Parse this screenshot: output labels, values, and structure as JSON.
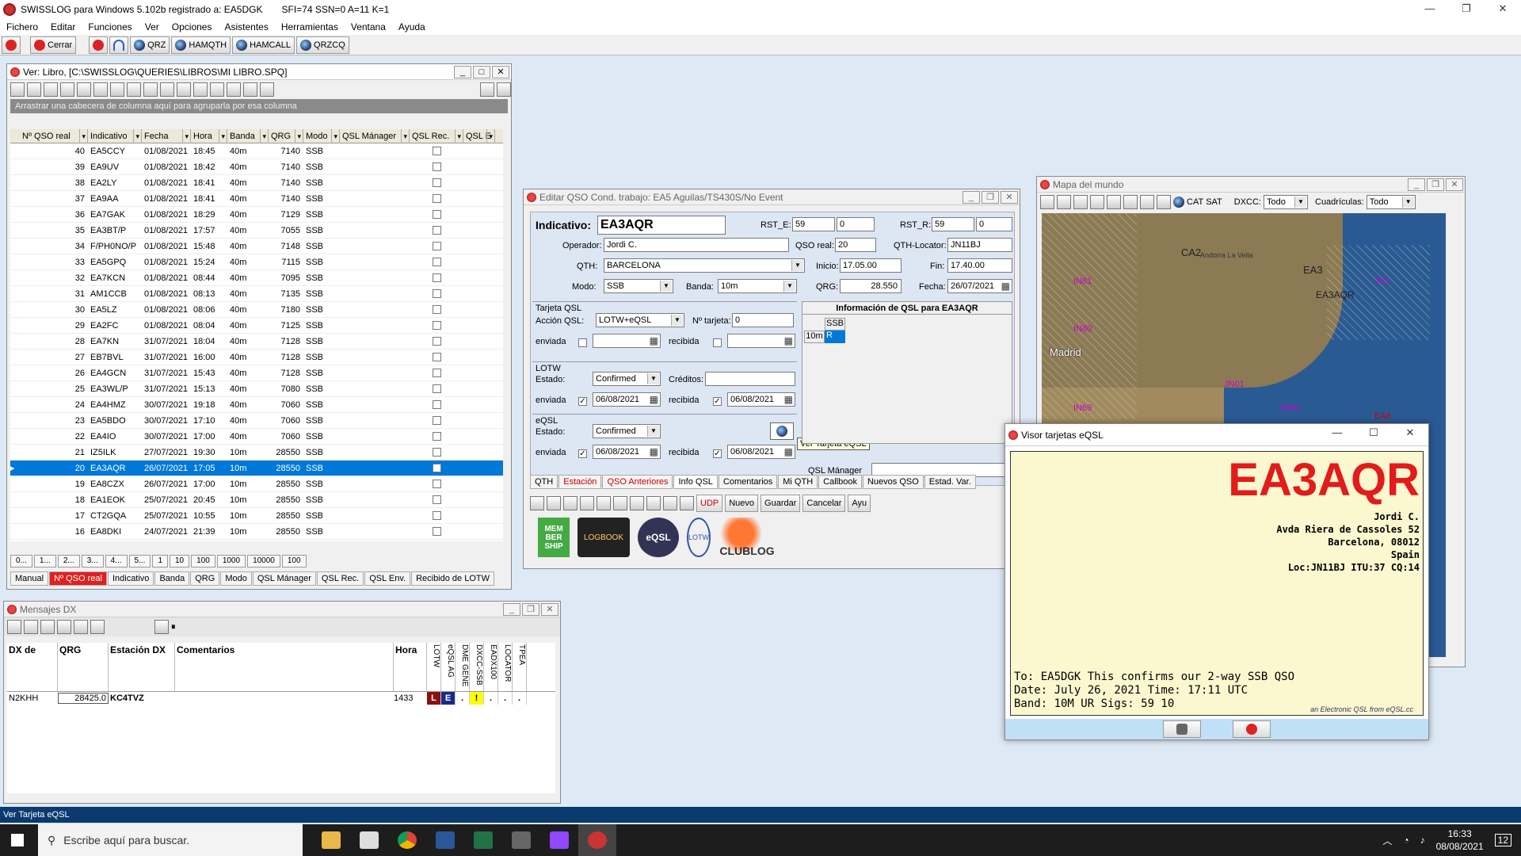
{
  "app": {
    "title": "SWISSLOG para Windows 5.102b registrado a: EA5DGK",
    "solar": "SFI=74 SSN=0 A=11 K=1"
  },
  "menu": [
    "Fichero",
    "Editar",
    "Funciones",
    "Ver",
    "Opciones",
    "Asistentes",
    "Herramientas",
    "Ventana",
    "Ayuda"
  ],
  "toolbar": {
    "close": "Cerrar",
    "qrz": "QRZ",
    "hamqth": "HAMQTH",
    "hamcall": "HAMCALL",
    "qrzcq": "QRZCQ"
  },
  "log": {
    "title": "Ver: Libro, [C:\\SWISSLOG\\QUERIES\\LIBROS\\MI LIBRO.SPQ]",
    "group_hint": "Arrastrar una cabecera de columna aquí para agruparla por esa columna",
    "columns": [
      "Nº QSO real",
      "Indicativo",
      "Fecha",
      "Hora",
      "Banda",
      "QRG",
      "Modo",
      "QSL Mánager",
      "QSL Rec.",
      "QSL E"
    ],
    "rows": [
      {
        "n": "40",
        "call": "EA5CCY",
        "date": "01/08/2021",
        "time": "18:45",
        "band": "40m",
        "qrg": "7140",
        "mode": "SSB"
      },
      {
        "n": "39",
        "call": "EA9UV",
        "date": "01/08/2021",
        "time": "18:42",
        "band": "40m",
        "qrg": "7140",
        "mode": "SSB"
      },
      {
        "n": "38",
        "call": "EA2LY",
        "date": "01/08/2021",
        "time": "18:41",
        "band": "40m",
        "qrg": "7140",
        "mode": "SSB"
      },
      {
        "n": "37",
        "call": "EA9AA",
        "date": "01/08/2021",
        "time": "18:41",
        "band": "40m",
        "qrg": "7140",
        "mode": "SSB"
      },
      {
        "n": "36",
        "call": "EA7GAK",
        "date": "01/08/2021",
        "time": "18:29",
        "band": "40m",
        "qrg": "7129",
        "mode": "SSB"
      },
      {
        "n": "35",
        "call": "EA3BT/P",
        "date": "01/08/2021",
        "time": "17:57",
        "band": "40m",
        "qrg": "7055",
        "mode": "SSB"
      },
      {
        "n": "34",
        "call": "F/PH0NO/P",
        "date": "01/08/2021",
        "time": "15:48",
        "band": "40m",
        "qrg": "7148",
        "mode": "SSB"
      },
      {
        "n": "33",
        "call": "EA5GPQ",
        "date": "01/08/2021",
        "time": "15:24",
        "band": "40m",
        "qrg": "7115",
        "mode": "SSB"
      },
      {
        "n": "32",
        "call": "EA7KCN",
        "date": "01/08/2021",
        "time": "08:44",
        "band": "40m",
        "qrg": "7095",
        "mode": "SSB"
      },
      {
        "n": "31",
        "call": "AM1CCB",
        "date": "01/08/2021",
        "time": "08:13",
        "band": "40m",
        "qrg": "7135",
        "mode": "SSB"
      },
      {
        "n": "30",
        "call": "EA5LZ",
        "date": "01/08/2021",
        "time": "08:06",
        "band": "40m",
        "qrg": "7180",
        "mode": "SSB"
      },
      {
        "n": "29",
        "call": "EA2FC",
        "date": "01/08/2021",
        "time": "08:04",
        "band": "40m",
        "qrg": "7125",
        "mode": "SSB"
      },
      {
        "n": "28",
        "call": "EA7KN",
        "date": "31/07/2021",
        "time": "18:04",
        "band": "40m",
        "qrg": "7128",
        "mode": "SSB"
      },
      {
        "n": "27",
        "call": "EB7BVL",
        "date": "31/07/2021",
        "time": "16:00",
        "band": "40m",
        "qrg": "7128",
        "mode": "SSB"
      },
      {
        "n": "26",
        "call": "EA4GCN",
        "date": "31/07/2021",
        "time": "15:43",
        "band": "40m",
        "qrg": "7128",
        "mode": "SSB"
      },
      {
        "n": "25",
        "call": "EA3WL/P",
        "date": "31/07/2021",
        "time": "15:13",
        "band": "40m",
        "qrg": "7080",
        "mode": "SSB"
      },
      {
        "n": "24",
        "call": "EA4HMZ",
        "date": "30/07/2021",
        "time": "19:18",
        "band": "40m",
        "qrg": "7060",
        "mode": "SSB"
      },
      {
        "n": "23",
        "call": "EA5BDO",
        "date": "30/07/2021",
        "time": "17:10",
        "band": "40m",
        "qrg": "7060",
        "mode": "SSB"
      },
      {
        "n": "22",
        "call": "EA4IO",
        "date": "30/07/2021",
        "time": "17:00",
        "band": "40m",
        "qrg": "7060",
        "mode": "SSB"
      },
      {
        "n": "21",
        "call": "IZ5ILK",
        "date": "27/07/2021",
        "time": "19:30",
        "band": "10m",
        "qrg": "28550",
        "mode": "SSB"
      },
      {
        "n": "20",
        "call": "EA3AQR",
        "date": "26/07/2021",
        "time": "17:05",
        "band": "10m",
        "qrg": "28550",
        "mode": "SSB",
        "sel": true
      },
      {
        "n": "19",
        "call": "EA8CZX",
        "date": "26/07/2021",
        "time": "17:00",
        "band": "10m",
        "qrg": "28550",
        "mode": "SSB"
      },
      {
        "n": "18",
        "call": "EA1EOK",
        "date": "25/07/2021",
        "time": "20:45",
        "band": "10m",
        "qrg": "28550",
        "mode": "SSB"
      },
      {
        "n": "17",
        "call": "CT2GQA",
        "date": "25/07/2021",
        "time": "10:55",
        "band": "10m",
        "qrg": "28550",
        "mode": "SSB"
      },
      {
        "n": "16",
        "call": "EA8DKI",
        "date": "24/07/2021",
        "time": "21:39",
        "band": "10m",
        "qrg": "28550",
        "mode": "SSB"
      }
    ],
    "nav_labels": [
      "0...",
      "1...",
      "2...",
      "3...",
      "4...",
      "5...",
      "1",
      "10",
      "100",
      "1000",
      "10000",
      "100"
    ],
    "tabs": [
      "Manual",
      "Nº QSO real",
      "Indicativo",
      "Banda",
      "QRG",
      "Modo",
      "QSL Mánager",
      "QSL Rec.",
      "QSL Env.",
      "Recibido de LOTW"
    ]
  },
  "edit": {
    "title": "Editar QSO  Cond. trabajo: EA5 Aguilas/TS430S/No Event",
    "indicativo_label": "Indicativo:",
    "indicativo": "EA3AQR",
    "rst_e_label": "RST_E:",
    "rst_e": "59",
    "rst_e2": "0",
    "rst_r_label": "RST_R:",
    "rst_r": "59",
    "rst_r2": "0",
    "operador_label": "Operador:",
    "operador": "Jordi C.",
    "qso_real_label": "QSO real:",
    "qso_real": "20",
    "locator_label": "QTH-Locator:",
    "locator": "JN11BJ",
    "qth_label": "QTH:",
    "qth": "BARCELONA",
    "inicio_label": "Inicio:",
    "inicio": "17.05.00",
    "fin_label": "Fin:",
    "fin": "17.40.00",
    "modo_label": "Modo:",
    "modo": "SSB",
    "banda_label": "Banda:",
    "banda": "10m",
    "qrg_label": "QRG:",
    "qrg": "28.550",
    "fecha_label": "Fecha:",
    "fecha": "26/07/2021",
    "tarjeta_label": "Tarjeta QSL",
    "accion_label": "Acción QSL:",
    "accion": "LOTW+eQSL",
    "ntarjeta_label": "Nº tarjeta:",
    "ntarjeta": "0",
    "enviada": "enviada",
    "recibida": "recibida",
    "lotw_label": "LOTW",
    "estado_label": "Estado:",
    "lotw_estado": "Confirmed",
    "creditos_label": "Créditos:",
    "lotw_env": "06/08/2021",
    "lotw_rec": "06/08/2021",
    "eqsl_label": "eQSL",
    "eqsl_estado": "Confirmed",
    "eqsl_env": "06/08/2021",
    "eqsl_rec": "06/08/2021",
    "tooltip": "Ver Tarjeta eQSL",
    "qslinfo_title": "Información de QSL para EA3AQR",
    "qslinfo_col": "SSB",
    "qslinfo_band": "10m",
    "qslinfo_val": "R",
    "manager_label": "QSL Mánager",
    "tabs": [
      "QTH",
      "Estación",
      "QSO Anteriores",
      "Info QSL",
      "Comentarios",
      "Mi QTH",
      "Callbook",
      "Nuevos QSO",
      "Estad. Var."
    ],
    "actions": {
      "udp": "UDP",
      "nuevo": "Nuevo",
      "guardar": "Guardar",
      "cancelar": "Cancelar",
      "ayuda": "Ayu"
    },
    "logos": [
      "MEM BER SHIP",
      "LOGBOOK",
      "eQSL",
      "LOTW",
      "CLUBLOG"
    ]
  },
  "map": {
    "title": "Mapa del mundo",
    "dxcc_label": "DXCC:",
    "dxcc": "Todo",
    "cuad_label": "Cuadrículas:",
    "cuad": "Todo",
    "cat": "CAT",
    "sat": "SAT",
    "labels": [
      "Andorra La Vella",
      "CA2",
      "EA3",
      "EA3AQR",
      "JN1",
      "IN81",
      "IN80",
      "IN69",
      "Madrid",
      "EA6",
      "JN01",
      "JN00"
    ]
  },
  "eqsl": {
    "title": "Visor tarjetas eQSL",
    "call": "EA3AQR",
    "name": "Jordi C.",
    "addr1": "Avda Riera de Cassoles 52",
    "addr2": "Barcelona, 08012",
    "country": "Spain",
    "loc": "Loc:JN11BJ ITU:37 CQ:14",
    "line1": "To: EA5DGK This confirms our 2-way SSB QSO",
    "line2": "Date: July 26, 2021  Time: 17:11 UTC",
    "line3": "Band: 10M UR Sigs: 59 10",
    "footer": "an Electronic QSL from eQSL.cc"
  },
  "dx": {
    "title": "Mensajes DX",
    "columns": [
      "DX de",
      "QRG",
      "Estación DX",
      "Comentarios",
      "Hora",
      "LOTW",
      "eQSL AG",
      "DME GENE",
      "DXCC-SSB",
      "EADX100",
      "LOCATOR",
      "TPEA"
    ],
    "row": {
      "from": "N2KHH",
      "qrg": "28425.0",
      "dx": "KC4TVZ",
      "hora": "1433",
      "flags": [
        "L",
        "E",
        ".",
        "!",
        ".",
        ".",
        "."
      ]
    }
  },
  "status": "Ver Tarjeta eQSL",
  "taskbar": {
    "search": "Escribe aquí para buscar.",
    "time": "16:33",
    "date": "08/08/2021",
    "notif": "12"
  }
}
